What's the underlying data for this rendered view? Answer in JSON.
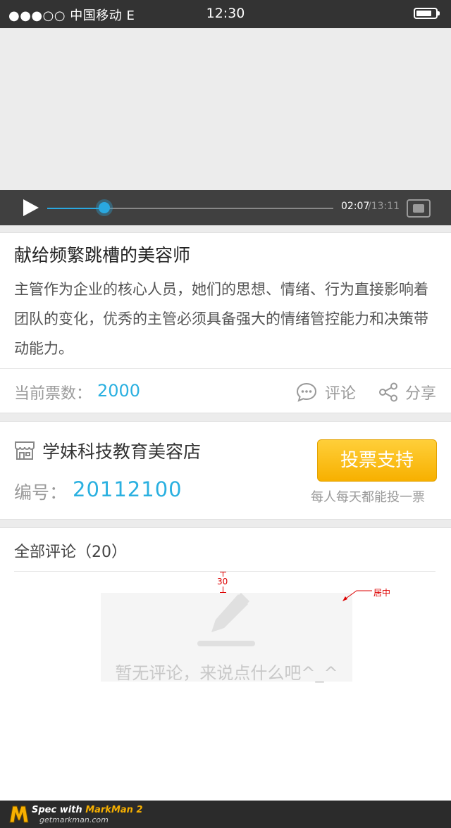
{
  "status_bar": {
    "carrier": "●●●○○ 中国移动 E",
    "time": "12:30",
    "battery_level": 0.8
  },
  "player": {
    "current_time": "02:07",
    "total_time": "/13:11",
    "progress": 0.2,
    "icons": [
      "play-icon",
      "fullscreen-icon"
    ],
    "accent_color": "#2aa8e0"
  },
  "video_info": {
    "title": "献给频繁跳槽的美容师",
    "description": "主管作为企业的核心人员，她们的思想、情绪、行为直接影响着团队的变化，优秀的主管必须具备强大的情绪管控能力和决策带动能力。",
    "votes_label": "当前票数：",
    "votes_value": "2000",
    "comment_label": "评论",
    "share_label": "分享"
  },
  "store": {
    "name": "学妹科技教育美容店",
    "number_label": "编号：",
    "number": "20112100",
    "vote_button": "投票支持",
    "vote_hint": "每人每天都能投一票",
    "button_color": "#f7b000"
  },
  "comments": {
    "title": "全部评论（20）",
    "empty_text": "暂无评论，来说点什么吧^_^"
  },
  "annotations": {
    "spacing": "30",
    "center_note": "居中"
  },
  "footer": {
    "spec_prefix": "Spec with ",
    "spec_brand": "MarkMan 2",
    "url": "getmarkman.com"
  }
}
